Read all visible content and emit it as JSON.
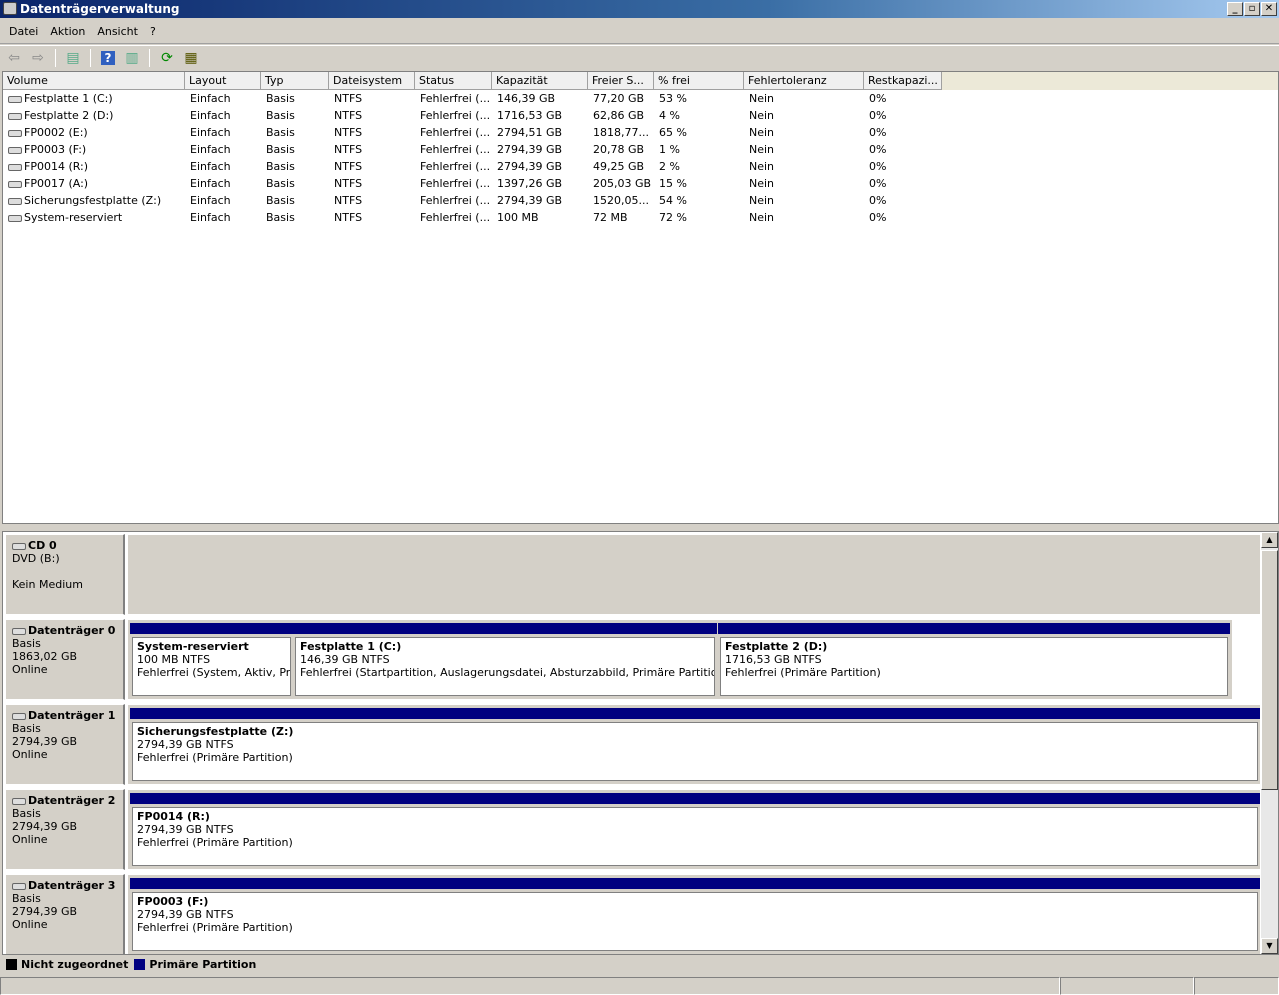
{
  "window": {
    "title": "Datenträgerverwaltung",
    "minimize": "_",
    "restore": "▫",
    "close": "✕"
  },
  "menu": [
    "Datei",
    "Aktion",
    "Ansicht",
    "?"
  ],
  "toolbar": [
    "back-icon",
    "forward-icon",
    "console-tree-icon",
    "help-icon",
    "action-pane-icon",
    "refresh-icon",
    "properties-icon"
  ],
  "columns": [
    "Volume",
    "Layout",
    "Typ",
    "Dateisystem",
    "Status",
    "Kapazität",
    "Freier S...",
    "% frei",
    "Fehlertoleranz",
    "Restkapazi..."
  ],
  "volumes": [
    [
      "Festplatte 1 (C:)",
      "Einfach",
      "Basis",
      "NTFS",
      "Fehlerfrei (...",
      "146,39 GB",
      "77,20 GB",
      "53 %",
      "Nein",
      "0%"
    ],
    [
      "Festplatte 2 (D:)",
      "Einfach",
      "Basis",
      "NTFS",
      "Fehlerfrei (...",
      "1716,53 GB",
      "62,86 GB",
      "4 %",
      "Nein",
      "0%"
    ],
    [
      "FP0002 (E:)",
      "Einfach",
      "Basis",
      "NTFS",
      "Fehlerfrei (...",
      "2794,51 GB",
      "1818,77...",
      "65 %",
      "Nein",
      "0%"
    ],
    [
      "FP0003 (F:)",
      "Einfach",
      "Basis",
      "NTFS",
      "Fehlerfrei (...",
      "2794,39 GB",
      "20,78 GB",
      "1 %",
      "Nein",
      "0%"
    ],
    [
      "FP0014 (R:)",
      "Einfach",
      "Basis",
      "NTFS",
      "Fehlerfrei (...",
      "2794,39 GB",
      "49,25 GB",
      "2 %",
      "Nein",
      "0%"
    ],
    [
      "FP0017 (A:)",
      "Einfach",
      "Basis",
      "NTFS",
      "Fehlerfrei (...",
      "1397,26 GB",
      "205,03 GB",
      "15 %",
      "Nein",
      "0%"
    ],
    [
      "Sicherungsfestplatte (Z:)",
      "Einfach",
      "Basis",
      "NTFS",
      "Fehlerfrei (...",
      "2794,39 GB",
      "1520,05...",
      "54 %",
      "Nein",
      "0%"
    ],
    [
      "System-reserviert",
      "Einfach",
      "Basis",
      "NTFS",
      "Fehlerfrei (...",
      "100 MB",
      "72 MB",
      "72 %",
      "Nein",
      "0%"
    ]
  ],
  "disks": [
    {
      "name": "CD 0",
      "type": "DVD (B:)",
      "size": "",
      "state": "Kein Medium",
      "partitions": []
    },
    {
      "name": "Datenträger 0",
      "type": "Basis",
      "size": "1863,02 GB",
      "state": "Online",
      "partitions": [
        {
          "name": "System-reserviert",
          "size": "100 MB NTFS",
          "status": "Fehlerfrei (System, Aktiv, Primäre Partition)"
        },
        {
          "name": "Festplatte 1  (C:)",
          "size": "146,39 GB NTFS",
          "status": "Fehlerfrei (Startpartition, Auslagerungsdatei, Absturzabbild, Primäre Partition)"
        },
        {
          "name": "Festplatte 2  (D:)",
          "size": "1716,53 GB NTFS",
          "status": "Fehlerfrei (Primäre Partition)"
        }
      ]
    },
    {
      "name": "Datenträger 1",
      "type": "Basis",
      "size": "2794,39 GB",
      "state": "Online",
      "partitions": [
        {
          "name": "Sicherungsfestplatte  (Z:)",
          "size": "2794,39 GB NTFS",
          "status": "Fehlerfrei (Primäre Partition)"
        }
      ]
    },
    {
      "name": "Datenträger 2",
      "type": "Basis",
      "size": "2794,39 GB",
      "state": "Online",
      "partitions": [
        {
          "name": "FP0014  (R:)",
          "size": "2794,39 GB NTFS",
          "status": "Fehlerfrei (Primäre Partition)"
        }
      ]
    },
    {
      "name": "Datenträger 3",
      "type": "Basis",
      "size": "2794,39 GB",
      "state": "Online",
      "partitions": [
        {
          "name": "FP0003  (F:)",
          "size": "2794,39 GB NTFS",
          "status": "Fehlerfrei (Primäre Partition)"
        }
      ]
    }
  ],
  "legend": [
    {
      "label": "Nicht zugeordnet",
      "color": "#000000"
    },
    {
      "label": "Primäre Partition",
      "color": "#000080"
    }
  ]
}
